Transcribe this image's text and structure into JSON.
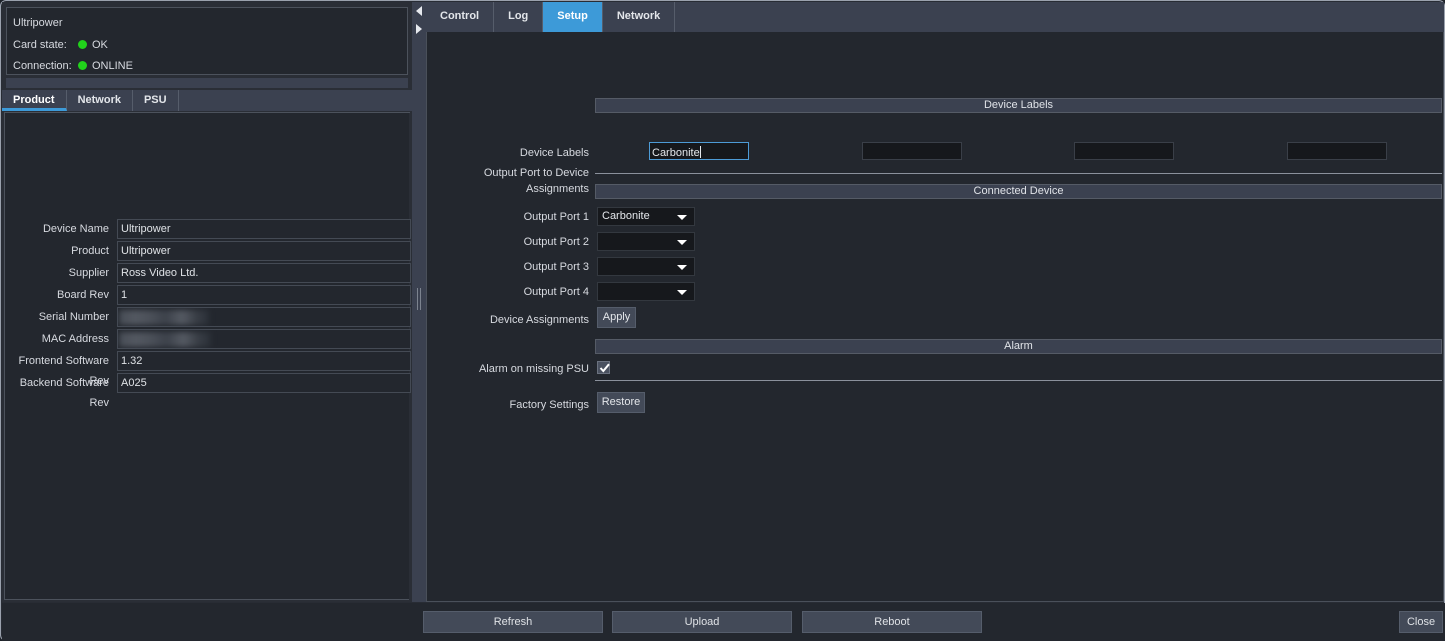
{
  "window": {
    "device_title": "Ultripower",
    "card_state_label": "Card state:",
    "card_state_value": "OK",
    "connection_label": "Connection:",
    "connection_value": "ONLINE",
    "led_color": "#21d21b"
  },
  "left_tabs": [
    {
      "label": "Product",
      "active": true
    },
    {
      "label": "Network",
      "active": false
    },
    {
      "label": "PSU",
      "active": false
    }
  ],
  "product_form": {
    "rows": [
      {
        "label": "Device Name",
        "value": "Ultripower",
        "redacted": false
      },
      {
        "label": "Product",
        "value": "Ultripower",
        "redacted": false
      },
      {
        "label": "Supplier",
        "value": "Ross Video Ltd.",
        "redacted": false
      },
      {
        "label": "Board Rev",
        "value": "1",
        "redacted": false
      },
      {
        "label": "Serial Number",
        "value": "",
        "redacted": true
      },
      {
        "label": "MAC Address",
        "value": "",
        "redacted": true
      },
      {
        "label": "Frontend Software Rev",
        "value": "1.32",
        "redacted": false
      },
      {
        "label": "Backend Software Rev",
        "value": "A025",
        "redacted": false
      }
    ]
  },
  "right_tabs": [
    {
      "label": "Control",
      "active": false
    },
    {
      "label": "Log",
      "active": false
    },
    {
      "label": "Setup",
      "active": true
    },
    {
      "label": "Network",
      "active": false
    }
  ],
  "setup": {
    "device_labels_group_title": "Device Labels",
    "device_labels_row_label": "Device Labels",
    "device_label_inputs": [
      {
        "value": "Carbonite",
        "focused": true,
        "placeholder": ""
      },
      {
        "value": "",
        "focused": false,
        "placeholder": ""
      },
      {
        "value": "",
        "focused": false,
        "placeholder": ""
      },
      {
        "value": "",
        "focused": false,
        "placeholder": ""
      }
    ],
    "assignments_section_label": "Output Port to Device Assignments",
    "connected_device_group_title": "Connected Device",
    "output_ports": [
      {
        "label": "Output Port 1",
        "value": "Carbonite"
      },
      {
        "label": "Output Port 2",
        "value": ""
      },
      {
        "label": "Output Port 3",
        "value": ""
      },
      {
        "label": "Output Port 4",
        "value": ""
      }
    ],
    "device_assignments_label": "Device Assignments",
    "apply_button": "Apply",
    "alarm_group_title": "Alarm",
    "alarm_psu_label": "Alarm on missing PSU",
    "alarm_psu_checked": true,
    "factory_settings_label": "Factory Settings",
    "restore_button": "Restore"
  },
  "bottom_bar": {
    "refresh": "Refresh",
    "upload": "Upload",
    "reboot": "Reboot",
    "close": "Close"
  },
  "colors": {
    "accent_blue": "#3d9ad8",
    "panel_bg": "#23272e",
    "chrome_bg": "#3b4150",
    "status_green": "#21d21b"
  }
}
